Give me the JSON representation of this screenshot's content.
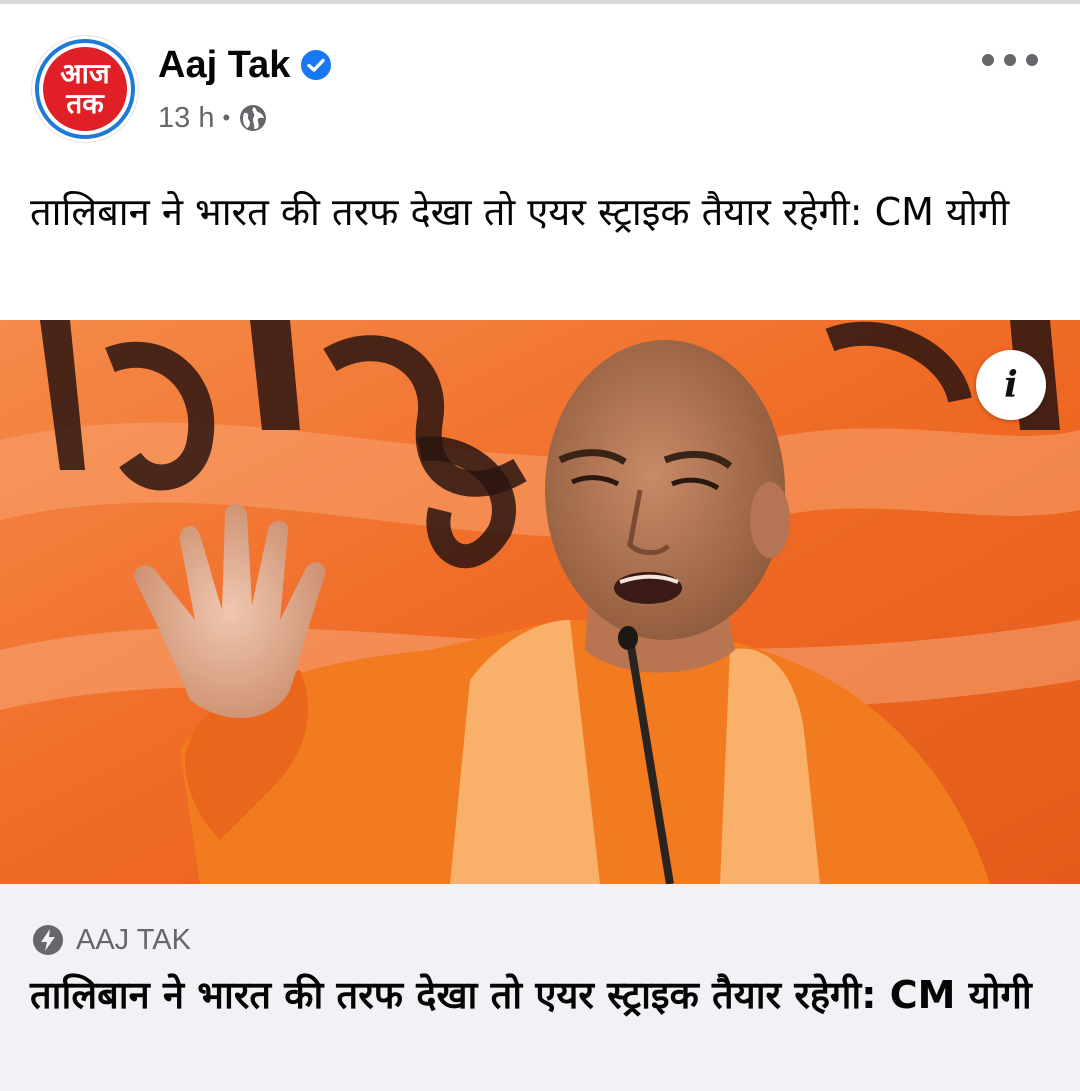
{
  "post": {
    "page_name": "Aaj Tak",
    "avatar_text": [
      "आज",
      "तक"
    ],
    "timestamp": "13 h",
    "separator": "•",
    "privacy_icon": "globe-icon",
    "verified_icon": "verified-badge-icon",
    "more_icon": "more-options-icon",
    "text": "तालिबान ने भारत की तरफ देखा तो एयर स्ट्राइक तैयार रहेगी: CM योगी"
  },
  "link_preview": {
    "info_label": "i",
    "source_icon": "bolt-icon",
    "source": "AAJ TAK",
    "title": "तालिबान ने भारत की तरफ देखा तो एयर स्ट्राइक तैयार रहेगी: CM योगी"
  },
  "colors": {
    "brand_red": "#e11f26",
    "verified_blue": "#1877f2",
    "secondary_text": "#65676b",
    "footer_bg": "#f0f2f5",
    "image_orange": "#f06a22"
  }
}
